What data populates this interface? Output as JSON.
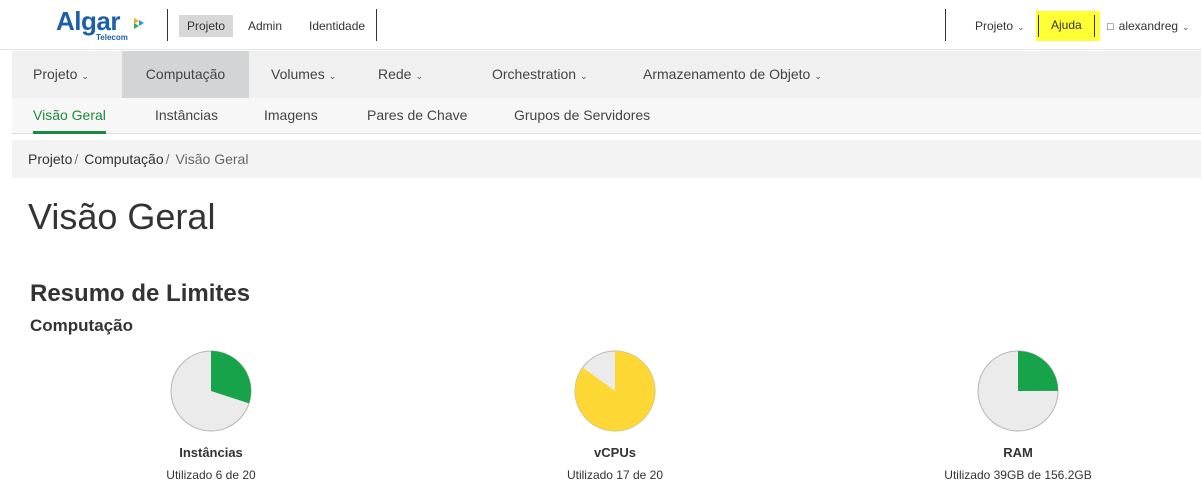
{
  "header": {
    "logo_text": "Algar",
    "logo_sub": "Telecom",
    "tabs": [
      {
        "label": "Projeto"
      },
      {
        "label": "Admin"
      },
      {
        "label": "Identidade"
      }
    ],
    "project_menu": "Projeto",
    "help_label": "Ajuda",
    "user_label": "alexandreg",
    "user_icon_glyph": "□"
  },
  "main_nav": {
    "items": [
      {
        "label": "Projeto"
      },
      {
        "label": "Computação"
      },
      {
        "label": "Volumes"
      },
      {
        "label": "Rede"
      },
      {
        "label": "Orchestration"
      },
      {
        "label": "Armazenamento de Objeto"
      }
    ]
  },
  "sub_nav": {
    "items": [
      {
        "label": "Visão Geral"
      },
      {
        "label": "Instâncias"
      },
      {
        "label": "Imagens"
      },
      {
        "label": "Pares de Chave"
      },
      {
        "label": "Grupos de Servidores"
      }
    ]
  },
  "breadcrumb": {
    "items": [
      "Projeto",
      "Computação",
      "Visão Geral"
    ],
    "separator": "/"
  },
  "page": {
    "title": "Visão Geral",
    "section_title": "Resumo de Limites",
    "subsection_title": "Computação"
  },
  "colors": {
    "green": "#17a34a",
    "yellow": "#fdd835",
    "pie_bg": "#ebebeb",
    "pie_border": "#b5b5b5",
    "highlight": "#ffff33",
    "active_green": "#1a8a3e"
  },
  "limits": [
    {
      "label": "Instâncias",
      "usage_text": "Utilizado 6 de 20",
      "used": 6,
      "total": 20,
      "color_key": "green"
    },
    {
      "label": "vCPUs",
      "usage_text": "Utilizado 17 de 20",
      "used": 17,
      "total": 20,
      "color_key": "yellow"
    },
    {
      "label": "RAM",
      "usage_text": "Utilizado 39GB de 156.2GB",
      "used": 39,
      "total": 156.2,
      "color_key": "green"
    }
  ]
}
